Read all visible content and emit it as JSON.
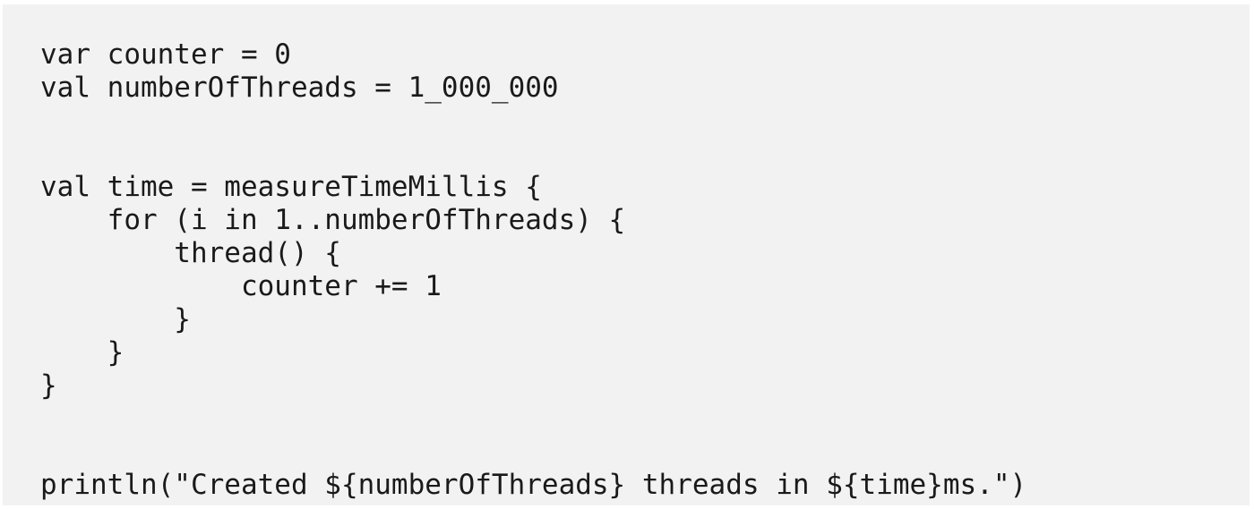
{
  "code": {
    "lines": [
      "var counter = 0",
      "val numberOfThreads = 1_000_000",
      "",
      "",
      "val time = measureTimeMillis {",
      "    for (i in 1..numberOfThreads) {",
      "        thread() {",
      "            counter += 1",
      "        }",
      "    }",
      "}",
      "",
      "",
      "println(\"Created ${numberOfThreads} threads in ${time}ms.\")"
    ]
  }
}
